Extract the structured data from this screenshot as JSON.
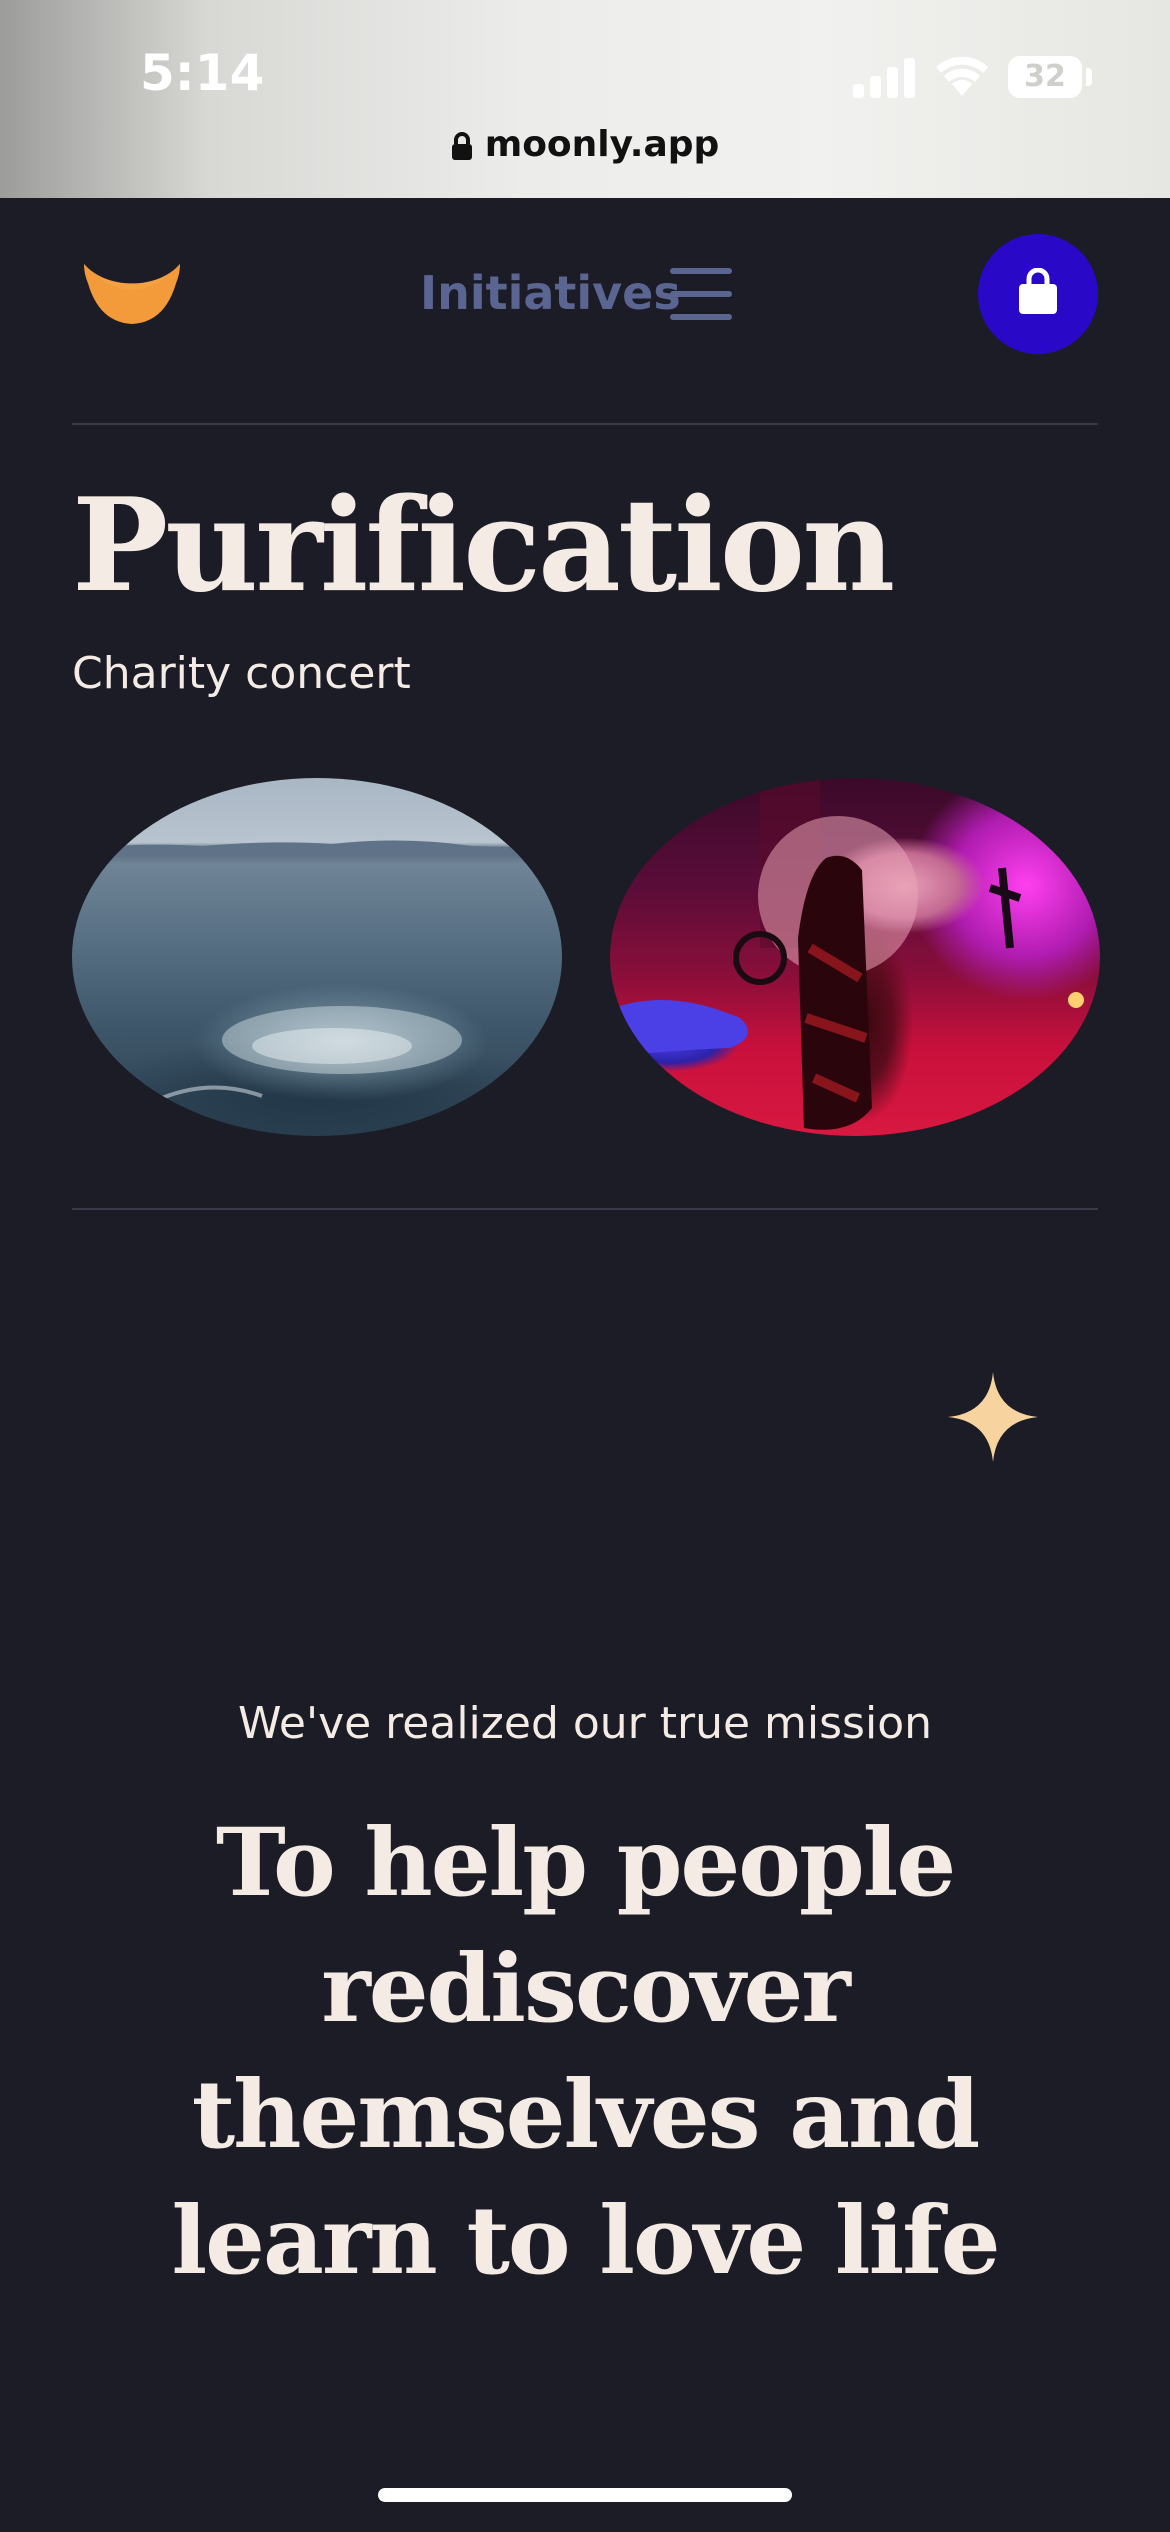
{
  "status_bar": {
    "time": "5:14",
    "battery": "32"
  },
  "browser": {
    "url": "moonly.app"
  },
  "header": {
    "logo_icon": "crescent-moon-icon",
    "nav_label": "Initiatives",
    "menu_icon": "hamburger-menu-icon",
    "cart_icon": "shopping-bag-icon"
  },
  "hero": {
    "title": "Purification",
    "subtitle": "Charity concert",
    "images": [
      "sea-photo",
      "concert-photo"
    ]
  },
  "mission": {
    "eyebrow": "We've realized our true mission",
    "statement": "To help people rediscover themselves and learn to love life"
  },
  "colors": {
    "background": "#1b1c26",
    "text": "#f4ece4",
    "nav": "#5b6591",
    "cart_button": "#2a08c8",
    "logo": "#f5a043",
    "sparkle": "#f7d3a0"
  }
}
